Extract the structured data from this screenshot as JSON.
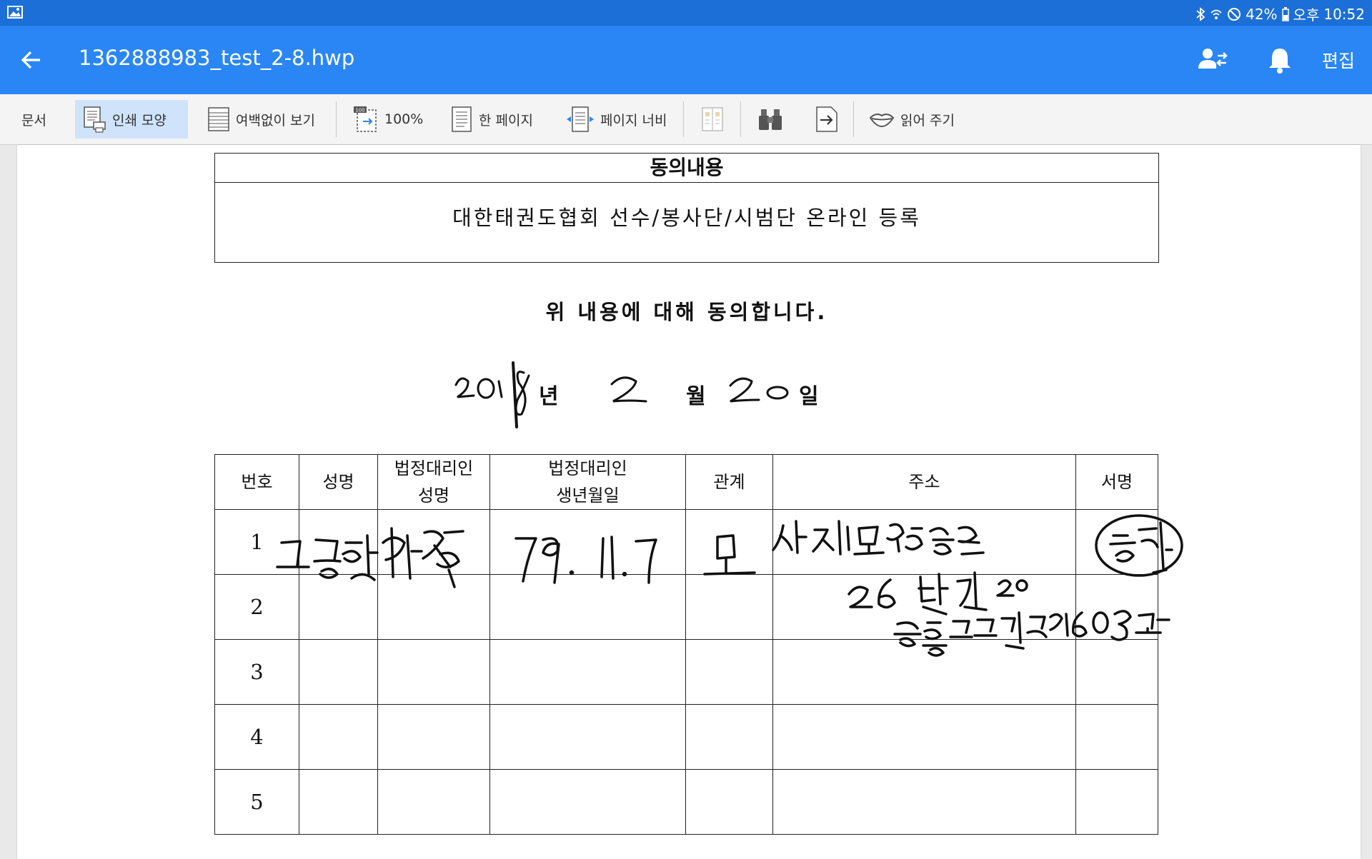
{
  "status_bar": {
    "battery": "42%",
    "time_prefix": "오후",
    "time": "10:52"
  },
  "app_bar": {
    "title": "1362888983_test_2-8.hwp",
    "edit_label": "편집"
  },
  "toolbar": {
    "doc_label": "문서",
    "print_layout": "인쇄 모양",
    "no_margin": "여백없이 보기",
    "zoom": "100%",
    "one_page": "한 페이지",
    "page_width": "페이지 너비",
    "read_aloud": "읽어 주기"
  },
  "document": {
    "consent_header": "동의내용",
    "consent_body": "대한태권도협회 선수/봉사단/시범단 온라인 등록",
    "agree_statement": "위 내용에 대해 동의합니다.",
    "date": {
      "year_label": "년",
      "month_label": "월",
      "day_label": "일",
      "year": "2018",
      "month": "2",
      "day": "20"
    },
    "table": {
      "headers": [
        "번호",
        "성명",
        "법정대리인\n성명",
        "법정대리인\n생년월일",
        "관계",
        "주소",
        "서명"
      ],
      "rows": [
        "1",
        "2",
        "3",
        "4",
        "5"
      ]
    }
  },
  "colors": {
    "status_bar": "#1c6fd6",
    "app_bar": "#2a86f5",
    "active_tool": "#cfe4fb"
  }
}
